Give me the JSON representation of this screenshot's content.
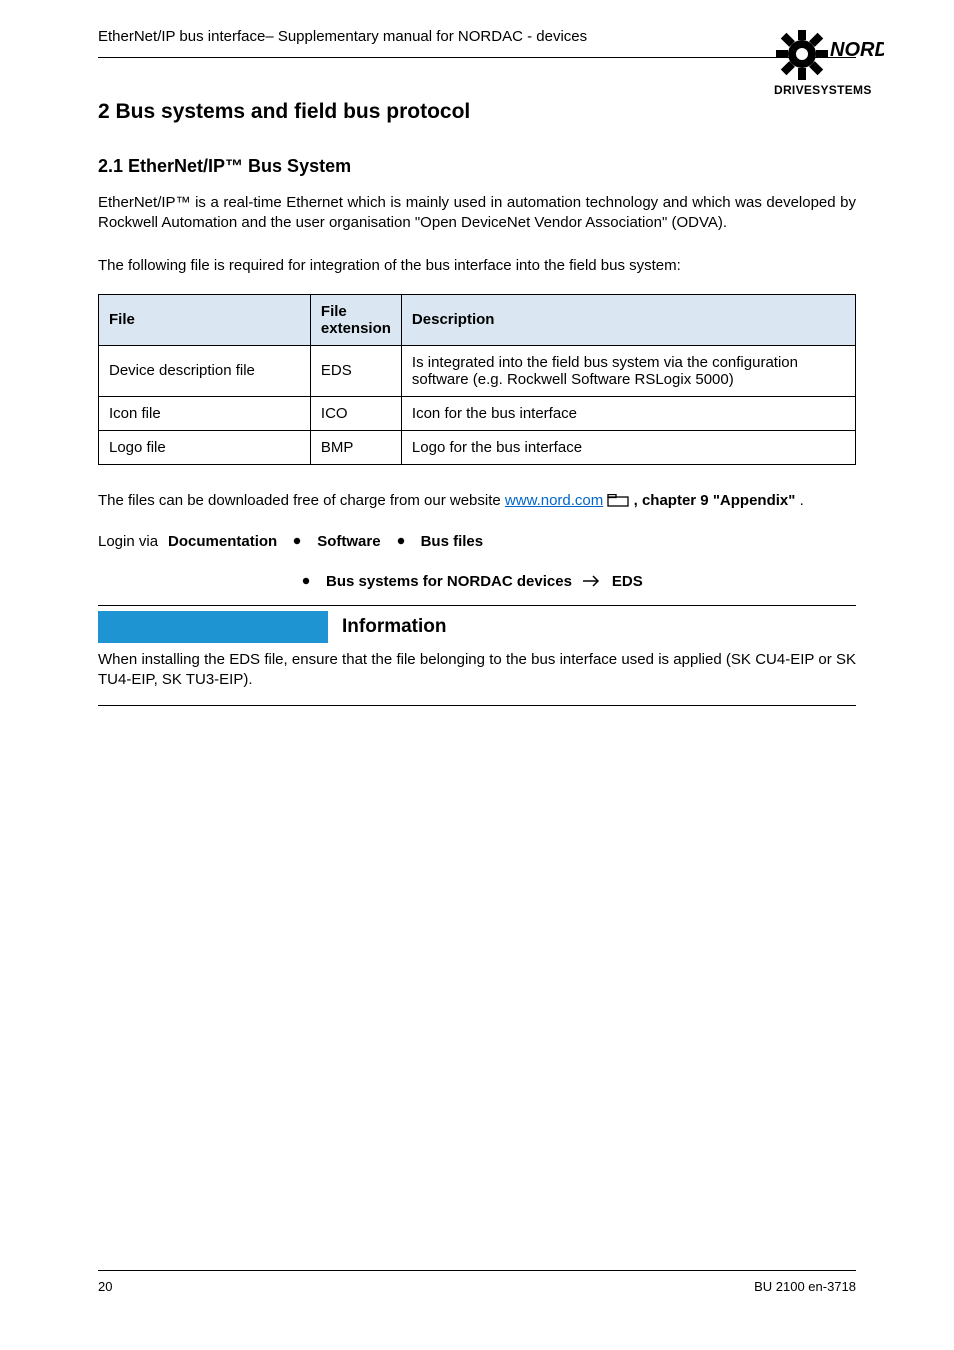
{
  "header": {
    "title_part1": "EtherNet/IP bus interface ",
    "title_part2": "– Supplementary manual for NORDAC - devices"
  },
  "logo": {
    "top": "NORD",
    "bottom": "DRIVESYSTEMS"
  },
  "section2": {
    "heading": "2 Bus systems and field bus protocol",
    "subheading": "2.1 EtherNet/IP™ Bus System",
    "p1": "EtherNet/IP™ is a real-time Ethernet which is mainly used in automation technology and which was developed by Rockwell Automation and the user organisation \"Open DeviceNet Vendor Association\" (ODVA).",
    "p2": "The following file is required for integration of the bus interface into the field bus system:"
  },
  "table": {
    "cols": {
      "file": "File",
      "ext": "File extension",
      "desc": "Description"
    },
    "rows": [
      {
        "file": "Device description file",
        "ext": "EDS",
        "desc": "Is integrated into the field bus system via the configuration software (e.g. Rockwell Software RSLogix 5000)"
      },
      {
        "file": "Icon file",
        "ext": "ICO",
        "desc": "Icon for the bus interface"
      },
      {
        "file": "Logo file",
        "ext": "BMP",
        "desc": "Logo for the bus interface"
      }
    ]
  },
  "section2_cont": {
    "p3_a": "The files can be downloaded free of charge from our website ",
    "p3_link": "www.nord.com",
    "p3_b": ", chapter 9 \"Appendix\"",
    "p3_c": "."
  },
  "login_procedure": {
    "label_prefix": "Login via",
    "step1": "Documentation",
    "step2": "Software",
    "step3": "Bus files",
    "step4": "Bus systems for NORDAC devices",
    "eds_label": "EDS"
  },
  "info": {
    "label": "Information",
    "body": "When installing the EDS file, ensure that the file belonging to the bus interface used is applied (SK CU4-EIP or SK TU4-EIP, SK TU3-EIP)."
  },
  "footer": {
    "left": "20",
    "right": "BU 2100 en-3718"
  }
}
